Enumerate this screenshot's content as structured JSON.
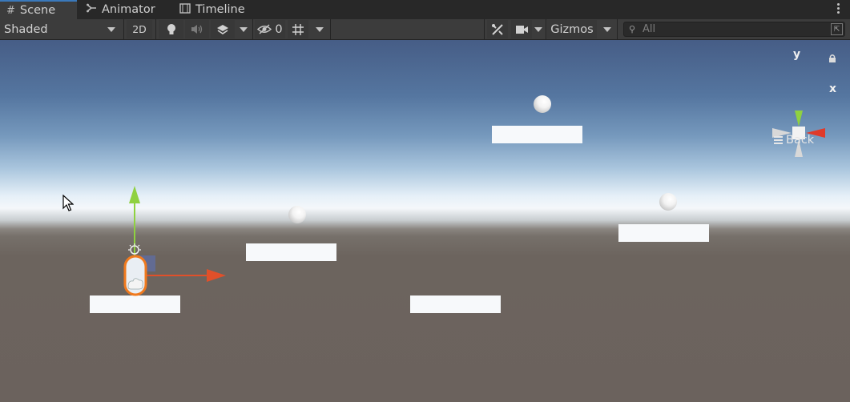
{
  "tabs": [
    {
      "label": "Scene",
      "icon": "hash-grid-icon",
      "active": true
    },
    {
      "label": "Animator",
      "icon": "animator-icon",
      "active": false
    },
    {
      "label": "Timeline",
      "icon": "film-strip-icon",
      "active": false
    }
  ],
  "toolbar": {
    "draw_mode": "Shaded",
    "mode_2d": "2D",
    "hidden_count": "0",
    "gizmos_label": "Gizmos",
    "search_placeholder": "All"
  },
  "orientation_gizmo": {
    "y_label": "y",
    "x_label": "x",
    "view_label": "Back",
    "colors": {
      "x": "#e03a2a",
      "y": "#8fd140"
    }
  },
  "scene_colors": {
    "sky_top": "#465d86",
    "horizon": "#f4f7fa",
    "ground": "#6b625d",
    "selection_outline": "#f07a1e"
  }
}
